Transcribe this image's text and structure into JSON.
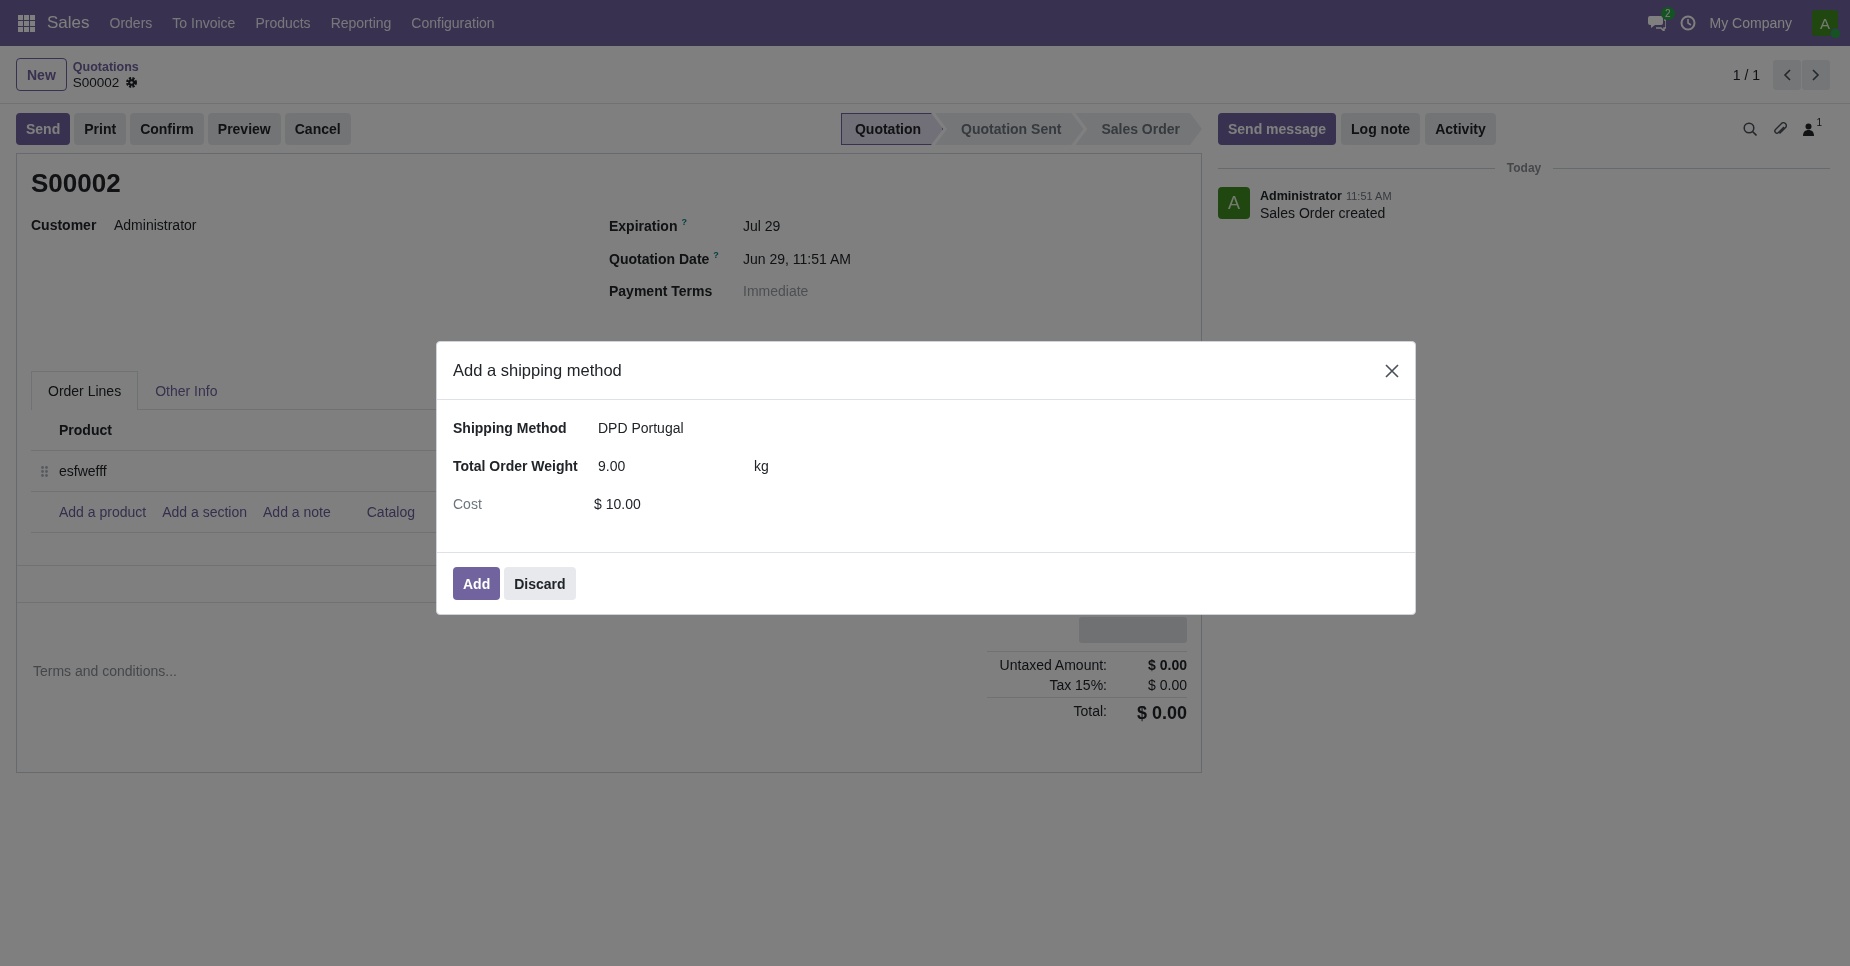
{
  "navbar": {
    "app": "Sales",
    "menu": [
      "Orders",
      "To Invoice",
      "Products",
      "Reporting",
      "Configuration"
    ],
    "chat_badge": "2",
    "company": "My Company",
    "avatar": "A"
  },
  "control_panel": {
    "new_button": "New",
    "breadcrumb": "Quotations",
    "record": "S00002",
    "pager": "1 / 1"
  },
  "actions": [
    {
      "label": "Send",
      "kind": "primary"
    },
    {
      "label": "Print",
      "kind": "secondary"
    },
    {
      "label": "Confirm",
      "kind": "secondary"
    },
    {
      "label": "Preview",
      "kind": "secondary"
    },
    {
      "label": "Cancel",
      "kind": "secondary"
    }
  ],
  "statusbar": [
    {
      "label": "Quotation",
      "selected": true
    },
    {
      "label": "Quotation Sent",
      "selected": false
    },
    {
      "label": "Sales Order",
      "selected": false
    }
  ],
  "form": {
    "title": "S00002",
    "left_fields": [
      {
        "label": "Customer",
        "value": "Administrator"
      }
    ],
    "right_fields": [
      {
        "label": "Expiration",
        "help": "?",
        "value": "Jul 29"
      },
      {
        "label": "Quotation Date",
        "help": "?",
        "value": "Jun 29, 11:51 AM"
      },
      {
        "label": "Payment Terms",
        "placeholder": "Immediate"
      }
    ],
    "tabs": [
      {
        "label": "Order Lines",
        "selected": true
      },
      {
        "label": "Other Info",
        "selected": false
      }
    ],
    "columns": [
      "Product"
    ],
    "rows": [
      "esfwefff"
    ],
    "add_links": [
      "Add a product",
      "Add a section",
      "Add a note",
      "Catalog"
    ],
    "terms_placeholder": "Terms and conditions...",
    "totals": [
      {
        "label": "Untaxed Amount:",
        "value": "$ 0.00",
        "kind": "subtotal"
      },
      {
        "label": "Tax 15%:",
        "value": "$ 0.00",
        "kind": "tax"
      },
      {
        "label": "Total:",
        "value": "$ 0.00",
        "kind": "total"
      }
    ]
  },
  "chatter": {
    "buttons": [
      {
        "label": "Send message",
        "kind": "primary"
      },
      {
        "label": "Log note",
        "kind": "secondary"
      },
      {
        "label": "Activity",
        "kind": "secondary"
      }
    ],
    "follower_count": "1",
    "divider": "Today",
    "messages": [
      {
        "avatar": "A",
        "author": "Administrator",
        "time": "11:51 AM",
        "body": "Sales Order created"
      }
    ]
  },
  "dialog": {
    "title": "Add a shipping method",
    "fields": [
      {
        "label": "Shipping Method",
        "value": "DPD Portugal",
        "kind": "field"
      },
      {
        "label": "Total Order Weight",
        "value": "9.00",
        "unit": "kg",
        "kind": "field"
      },
      {
        "label": "Cost",
        "value": "$ 10.00",
        "kind": "readonly"
      }
    ],
    "buttons": [
      {
        "label": "Add",
        "kind": "primary"
      },
      {
        "label": "Discard",
        "kind": "secondary"
      }
    ]
  }
}
